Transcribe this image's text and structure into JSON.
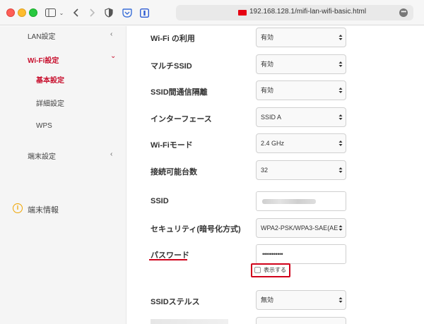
{
  "browser": {
    "url": "192.168.128.1/mifi-lan-wifi-basic.html"
  },
  "sidebar": {
    "lan": "LAN設定",
    "wifi": "Wi-Fi設定",
    "wifi_sub": [
      "基本設定",
      "詳細設定",
      "WPS"
    ],
    "device": "端末設定",
    "info": "端末情報",
    "collapsed_chevron": "‹",
    "expanded_chevron": "⌄"
  },
  "form": {
    "wifi_use": {
      "label": "Wi-Fi の利用",
      "value": "有効"
    },
    "multi_ssid": {
      "label": "マルチSSID",
      "value": "有効"
    },
    "ssid_isolation": {
      "label": "SSID間通信隔離",
      "value": "有効"
    },
    "interface": {
      "label": "インターフェース",
      "value": "SSID A"
    },
    "wifi_mode": {
      "label": "Wi-Fiモード",
      "value": "2.4 GHz"
    },
    "max_clients": {
      "label": "接続可能台数",
      "value": "32"
    },
    "ssid": {
      "label": "SSID"
    },
    "security": {
      "label": "セキュリティ(暗号化方式)",
      "value": "WPA2-PSK/WPA3-SAE(AE"
    },
    "password": {
      "label": "パスワード",
      "value": "•••••••••••"
    },
    "show_password": {
      "label": "表示する"
    },
    "ssid_stealth": {
      "label": "SSIDステルス",
      "value": "無効"
    }
  },
  "colors": {
    "accent": "#c8102e",
    "annotation": "#d0021b"
  }
}
